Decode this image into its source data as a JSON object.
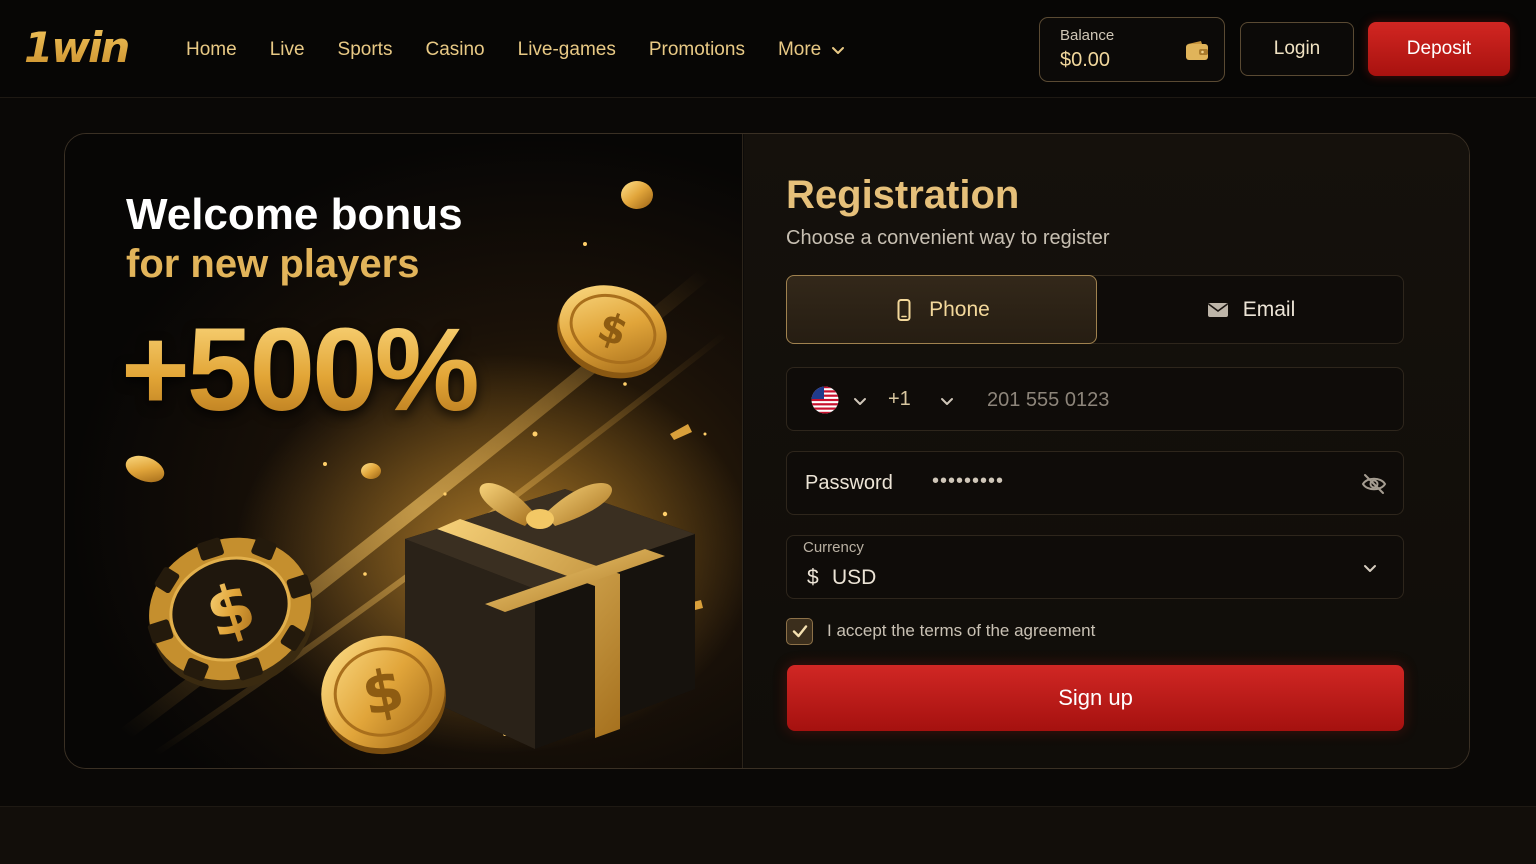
{
  "header": {
    "logo": "1win",
    "nav": [
      {
        "label": "Home"
      },
      {
        "label": "Live"
      },
      {
        "label": "Sports"
      },
      {
        "label": "Casino"
      },
      {
        "label": "Live-games"
      },
      {
        "label": "Promotions"
      },
      {
        "label": "More"
      }
    ],
    "balance_label": "Balance",
    "balance_value": "$0.00",
    "login_label": "Login",
    "deposit_label": "Deposit"
  },
  "promo": {
    "title": "Welcome bonus",
    "subtitle": "for new players",
    "bonus": "+500%"
  },
  "registration": {
    "title": "Registration",
    "subtitle": "Choose a convenient way to register",
    "tabs": [
      {
        "label": "Phone",
        "active": true,
        "icon": "phone-icon"
      },
      {
        "label": "Email",
        "active": false,
        "icon": "mail-icon"
      }
    ],
    "phone": {
      "country_flag": "us-flag-icon",
      "dial_code": "+1",
      "placeholder": "201 555 0123"
    },
    "password": {
      "label": "Password",
      "masked_value": "•••••••••"
    },
    "currency": {
      "label": "Currency",
      "symbol": "$",
      "value": "USD"
    },
    "terms_label": "I accept the terms of the agreement",
    "terms_checked": true,
    "signup_label": "Sign up"
  },
  "colors": {
    "accent_gold": "#e6c07a",
    "cta_red": "#c01d1a",
    "background": "#0a0806"
  }
}
